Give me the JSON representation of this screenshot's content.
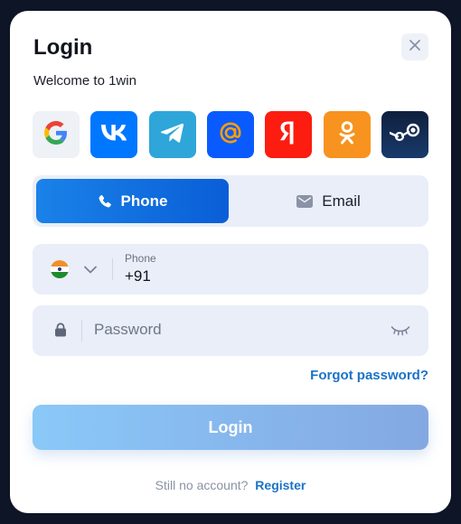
{
  "modal": {
    "title": "Login",
    "subtitle": "Welcome to 1win",
    "close_icon": "close-icon"
  },
  "social_logins": [
    {
      "name": "Google",
      "icon": "google-icon",
      "color": "#eef1f6"
    },
    {
      "name": "VK",
      "icon": "vk-icon",
      "color": "#0077ff"
    },
    {
      "name": "Telegram",
      "icon": "telegram-icon",
      "color": "#2ea6da"
    },
    {
      "name": "Mail.ru",
      "icon": "mail-ru-icon",
      "color": "#0a5bff"
    },
    {
      "name": "Yandex",
      "icon": "yandex-icon",
      "color": "#fc1c10"
    },
    {
      "name": "Odnoklassniki",
      "icon": "odnoklassniki-icon",
      "color": "#f7931e"
    },
    {
      "name": "Steam",
      "icon": "steam-icon",
      "color": "#183a6b"
    }
  ],
  "tabs": {
    "phone_label": "Phone",
    "email_label": "Email",
    "active": "Phone"
  },
  "phone_field": {
    "country_flag": "india-flag-icon",
    "label": "Phone",
    "value": "+91"
  },
  "password_field": {
    "placeholder": "Password"
  },
  "forgot_password": "Forgot password?",
  "login_button": "Login",
  "footer": {
    "question": "Still no account?",
    "register_link": "Register"
  },
  "colors": {
    "accent": "#1a73c7",
    "tab_active": "#0a5ed7",
    "field_bg": "#e9eef9",
    "backdrop": "#0d1526"
  }
}
